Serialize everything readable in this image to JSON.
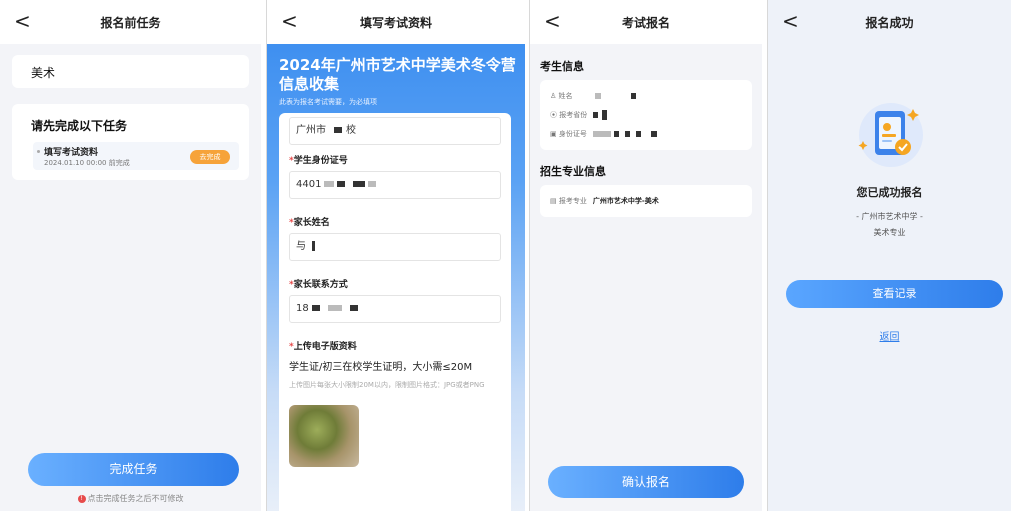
{
  "screen1": {
    "back": "<",
    "title": "报名前任务",
    "major": "美术",
    "task_heading": "请先完成以下任务",
    "task": {
      "name": "填写考试资料",
      "due": "2024.01.10 00:00 前完成",
      "badge": "去完成"
    },
    "finish_button": "完成任务",
    "warning": "点击完成任务之后不可修改"
  },
  "screen2": {
    "back": "<",
    "title": "填写考试资料",
    "banner_title": "2024年广州市艺术中学美术冬令营信息收集",
    "banner_subtitle": "此表为报名考试需要，为必填项",
    "school_value": "广州市",
    "school_suffix": "校",
    "id_label": "学生身份证号",
    "id_value": "4401",
    "parent_name_label": "家长姓名",
    "parent_name_value": "与",
    "parent_phone_label": "家长联系方式",
    "parent_phone_value": "18",
    "upload_label": "上传电子版资料",
    "upload_tip": "学生证/初三在校学生证明，大小需≤20M",
    "upload_note": "上传图片每张大小限制20M以内，限制图片格式：JPG或者PNG"
  },
  "screen3": {
    "back": "<",
    "title": "考试报名",
    "student_section": "考生信息",
    "name_label": "姓名",
    "province_label": "报考省份",
    "idcard_label": "身份证号",
    "major_section": "招生专业信息",
    "major_label": "报考专业",
    "major_value": "广州市艺术中学-美术",
    "confirm_button": "确认报名"
  },
  "screen4": {
    "back": "<",
    "title": "报名成功",
    "success_title": "您已成功报名",
    "detail_line1": "- 广州市艺术中学 -",
    "detail_line2": "美术专业",
    "record_button": "查看记录",
    "back_link": "返回"
  }
}
